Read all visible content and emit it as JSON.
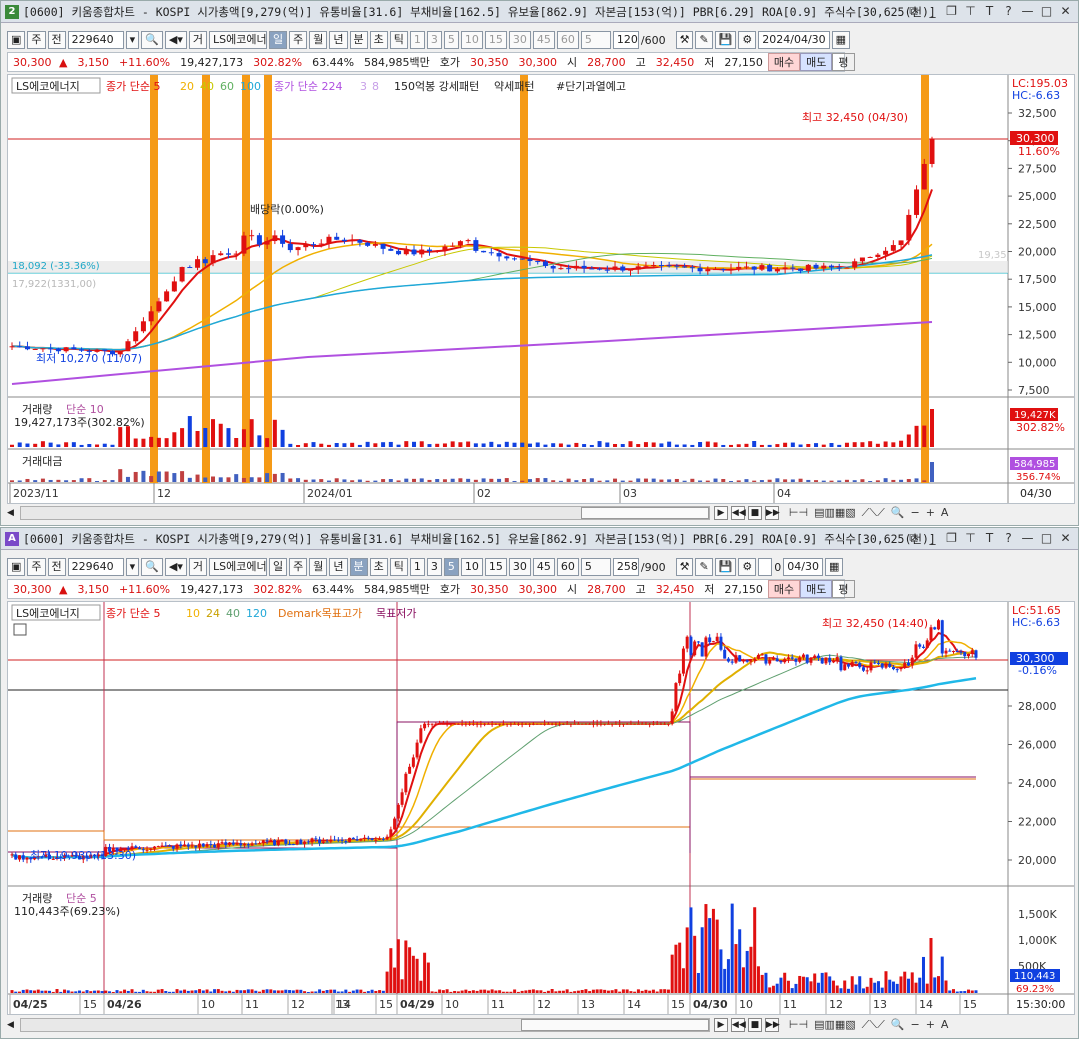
{
  "top": {
    "badge": "2",
    "badge_color": "#3a8a3a",
    "title": "[0600] 키움종합차트 - KOSPI 시가총액[9,279(억)] 유통비율[31.6] 부채비율[162.5] 유보율[862.9] 자본금[153(억)] PBR[6.29] ROA[0.9] 주식수[30,625(천)]",
    "toolbar": {
      "period": "주",
      "prev_label": "전",
      "code": "229640",
      "name": "LS에코에너지",
      "name_prefix": "거",
      "units": [
        "일",
        "주",
        "월",
        "년",
        "분",
        "초",
        "틱"
      ],
      "selected_unit": "일",
      "intervals": [
        "1",
        "3",
        "5",
        "10",
        "15",
        "30",
        "45",
        "60"
      ],
      "count_select": "5",
      "count": "120",
      "count_total": "/600",
      "date": "2024/04/30"
    },
    "quote": {
      "price": "30,300",
      "arrow": "▲",
      "change": "3,150",
      "rate": "+11.60%",
      "volume": "19,427,173",
      "vol_ratio": "302.82%",
      "turnover": "63.44%",
      "amount": "584,985백만",
      "bid_label": "호가",
      "bid": "30,350",
      "ask": "30,300",
      "open_label": "시",
      "open": "28,700",
      "high_label": "고",
      "high": "32,450",
      "low_label": "저",
      "low": "27,150",
      "buy": "매수",
      "sell": "매도",
      "flat": "평"
    },
    "legend": {
      "name": "LS에코에너지",
      "ma_label": "종가 단순 5",
      "ma_periods": [
        "20",
        "40",
        "60",
        "100"
      ],
      "ma2_label": "종가 단순 224",
      "ma2_periods": [
        "3",
        "8"
      ],
      "pattern1": "150억봉 강세패턴",
      "pattern2": "약세패턴",
      "pattern3": "#단기과열예고"
    },
    "annotations": {
      "max": "최고 32,450 (04/30)",
      "min": "최저 10,270 (11/07)",
      "dividend": "배당락(0.00%)",
      "level": "18,092 (-33.36%)",
      "level2": "17,922(1331,00)",
      "right_ghost": "19,35"
    },
    "price_axis": [
      "32,500",
      "30,000",
      "27,500",
      "25,000",
      "22,500",
      "20,000",
      "17,500",
      "15,000",
      "12,500",
      "10,000",
      "7,500"
    ],
    "price_tags": {
      "lc": "LC:195.03",
      "hc": "HC:-6.63",
      "cur": "30,300",
      "pct": "11.60%"
    },
    "volume": {
      "label": "거래량",
      "ma": "단순 10",
      "value": "19,427,173주(302.82%)",
      "tag": "19,427K",
      "tag_pct": "302.82%"
    },
    "amount_panel": {
      "label": "거래대금",
      "tag": "584,985",
      "tag_pct": "356.74%"
    },
    "date_axis": [
      "2023/11",
      "12",
      "2024/01",
      "02",
      "03",
      "04"
    ],
    "date_right": "04/30"
  },
  "bottom": {
    "badge": "A",
    "badge_color": "#7a4ac8",
    "title": "[0600] 키움종합차트 - KOSPI 시가총액[9,279(억)] 유통비율[31.6] 부채비율[162.5] 유보율[862.9] 자본금[153(억)] PBR[6.29] ROA[0.9] 주식수[30,625(천)]",
    "toolbar": {
      "period": "주",
      "prev_label": "전",
      "code": "229640",
      "name": "LS에코에너지",
      "name_prefix": "거",
      "units": [
        "일",
        "주",
        "월",
        "년",
        "분",
        "초",
        "틱"
      ],
      "selected_unit": "분",
      "intervals": [
        "1",
        "3",
        "5",
        "10",
        "15",
        "30",
        "45",
        "60"
      ],
      "selected_interval": "5",
      "count_select": "5",
      "count": "258",
      "count_total": "/900",
      "checkbox_label": "0",
      "date": "04/30"
    },
    "quote": {
      "price": "30,300",
      "arrow": "▲",
      "change": "3,150",
      "rate": "+11.60%",
      "volume": "19,427,173",
      "vol_ratio": "302.82%",
      "turnover": "63.44%",
      "amount": "584,985백만",
      "bid_label": "호가",
      "bid": "30,350",
      "ask": "30,300",
      "open_label": "시",
      "open": "28,700",
      "high_label": "고",
      "high": "32,450",
      "low_label": "저",
      "low": "27,150",
      "buy": "매수",
      "sell": "매도",
      "flat": "평"
    },
    "legend": {
      "name": "LS에코에너지",
      "ma_label": "종가 단순 5",
      "ma_periods": [
        "10",
        "24",
        "40",
        "120"
      ],
      "demark_high": "Demark목표고가",
      "demark_low": "목표저가"
    },
    "annotations": {
      "max": "최고 32,450 (14:40)",
      "min": "최저 19,930 (13:30)"
    },
    "price_axis": [
      "28,000",
      "26,000",
      "24,000",
      "22,000",
      "20,000"
    ],
    "price_tags": {
      "lc": "LC:51.65",
      "hc": "HC:-6.63",
      "cur": "30,300",
      "pct": "-0.16%"
    },
    "volume": {
      "label": "거래량",
      "ma": "단순 5",
      "value": "110,443주(69.23%)",
      "tag": "110,443",
      "tag_pct": "69.23%"
    },
    "vol_axis": [
      "1,500K",
      "1,000K",
      "500K"
    ],
    "time_axis": [
      "04/25",
      "15",
      "04/26",
      "10",
      "11",
      "12",
      "13",
      "14",
      "15",
      "04/29",
      "10",
      "11",
      "12",
      "13",
      "14",
      "15",
      "04/30",
      "10",
      "11",
      "12",
      "13",
      "14",
      "15"
    ],
    "time_right": "15:30:00"
  },
  "colors": {
    "up": "#e01010",
    "down": "#1040e0",
    "highlight": "#f59a16",
    "ma5": "#e01010",
    "ma20": "#f0b000",
    "ma40": "#c8c800",
    "ma60": "#60b060",
    "ma100": "#20a8d8",
    "ma224": "#b050e0"
  }
}
